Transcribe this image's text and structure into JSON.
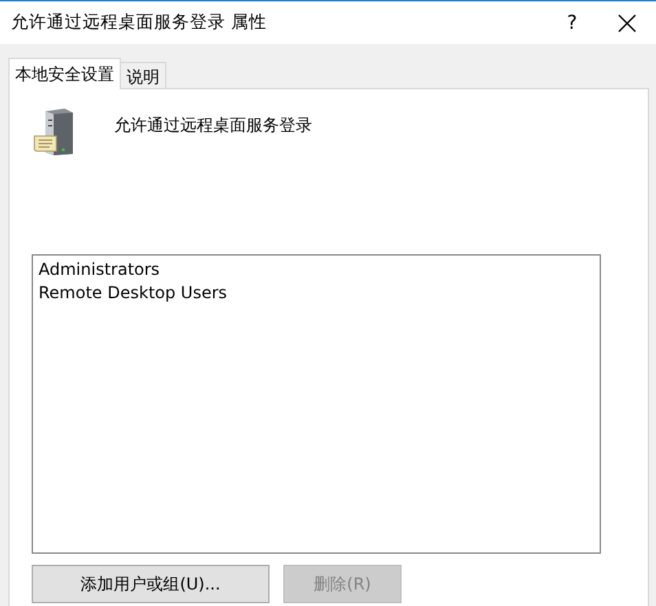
{
  "window": {
    "title": "允许通过远程桌面服务登录 属性",
    "help": "?"
  },
  "tabs": [
    {
      "label": "本地安全设置",
      "selected": true
    },
    {
      "label": "说明",
      "selected": false
    }
  ],
  "policy_name": "允许通过远程桌面服务登录",
  "members": [
    {
      "name": "Administrators",
      "selected": false
    },
    {
      "name": "Remote Desktop Users",
      "selected": false
    }
  ],
  "buttons": [
    {
      "label": "添加用户或组(U)...",
      "disabled": false
    },
    {
      "label": "删除(R)",
      "disabled": true
    }
  ]
}
